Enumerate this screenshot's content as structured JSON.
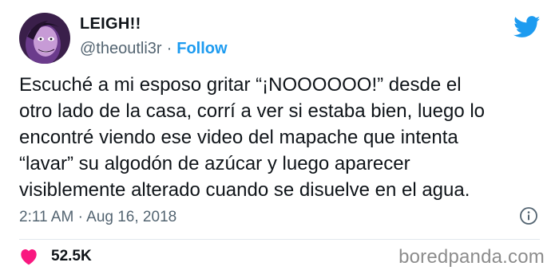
{
  "author": {
    "display_name": "LEIGH!!",
    "handle": "@theoutli3r",
    "separator": "·",
    "follow_label": "Follow"
  },
  "tweet": {
    "lines": [
      "Escuché a mi esposo gritar “¡NOOOOOO!” desde el",
      "otro lado de la casa, corrí a ver si estaba bien, luego lo",
      "encontré viendo ese video del mapache que intenta",
      "“lavar” su algodón de azúcar y luego aparecer",
      "visiblemente alterado cuando se disuelve en el agua."
    ]
  },
  "meta": {
    "time": "2:11 AM",
    "separator": "·",
    "date": "Aug 16, 2018"
  },
  "engagement": {
    "likes": "52.5K"
  },
  "watermark": "boredpanda.com",
  "colors": {
    "accent": "#1d9bf0",
    "heart": "#f91880",
    "secondary_text": "#536471",
    "primary_text": "#0f1419"
  },
  "icons": {
    "brand": "twitter-bird-icon",
    "info": "info-icon",
    "like": "heart-icon"
  }
}
